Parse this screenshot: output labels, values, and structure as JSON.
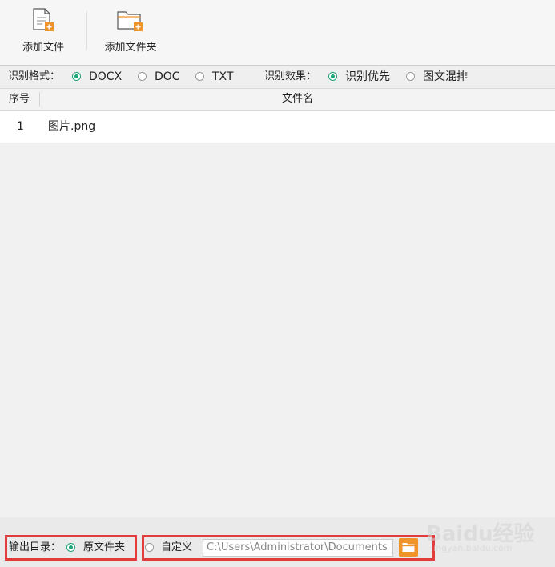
{
  "toolbar": {
    "add_file": "添加文件",
    "add_folder": "添加文件夹",
    "icons": {
      "add_file": "document-plus-icon",
      "add_folder": "folder-plus-icon"
    },
    "accent_color": "#f0932b"
  },
  "options": {
    "format_label": "识别格式：",
    "formats": [
      {
        "label": "DOCX",
        "selected": true
      },
      {
        "label": "DOC",
        "selected": false
      },
      {
        "label": "TXT",
        "selected": false
      }
    ],
    "effect_label": "识别效果：",
    "effects": [
      {
        "label": "识别优先",
        "selected": true
      },
      {
        "label": "图文混排",
        "selected": false
      }
    ]
  },
  "table": {
    "columns": [
      "序号",
      "文件名"
    ],
    "rows": [
      {
        "index": "1",
        "name": "图片.png"
      }
    ]
  },
  "output": {
    "label": "输出目录：",
    "original_folder": {
      "label": "原文件夹",
      "selected": true
    },
    "custom": {
      "label": "自定义",
      "selected": false
    },
    "path_value": "C:\\Users\\Administrator\\Documents",
    "browse_icon": "folder-icon"
  },
  "watermark": {
    "text": "Baidu经验",
    "sub": "jingyan.baidu.com"
  },
  "colors": {
    "radio_selected": "#1fa37a",
    "highlight": "#e33c3c"
  }
}
